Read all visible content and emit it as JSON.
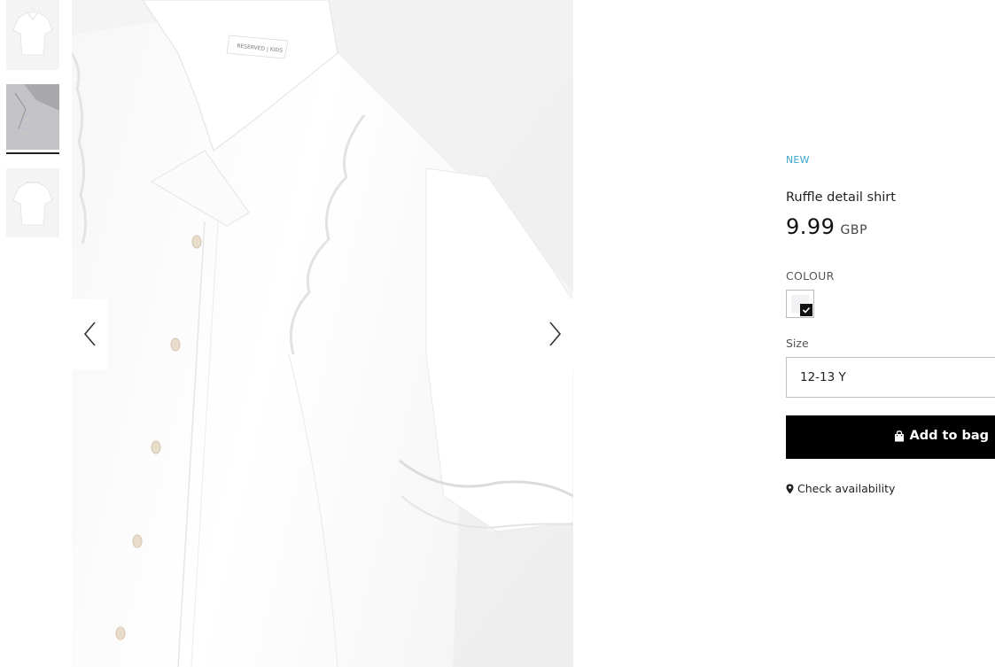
{
  "gallery": {
    "thumbnails": [
      {
        "alt": "shirt-front"
      },
      {
        "alt": "shirt-detail"
      },
      {
        "alt": "shirt-back"
      }
    ],
    "active_index": 1,
    "prev_icon": "chevron-left-icon",
    "next_icon": "chevron-right-icon"
  },
  "product": {
    "badge": "NEW",
    "name": "Ruffle detail shirt",
    "price": "9.99",
    "currency": "GBP",
    "colour_label": "COLOUR",
    "selected_colour": "#ffffff",
    "size_label": "Size",
    "size_value": "12-13 Y",
    "add_to_bag_label": "Add to bag",
    "add_to_bag_icon": "bag-icon",
    "check_availability_label": "Check availability",
    "check_availability_icon": "location-pin-icon"
  },
  "colors": {
    "accent_new": "#3aa6cf",
    "button_bg": "#000000"
  }
}
